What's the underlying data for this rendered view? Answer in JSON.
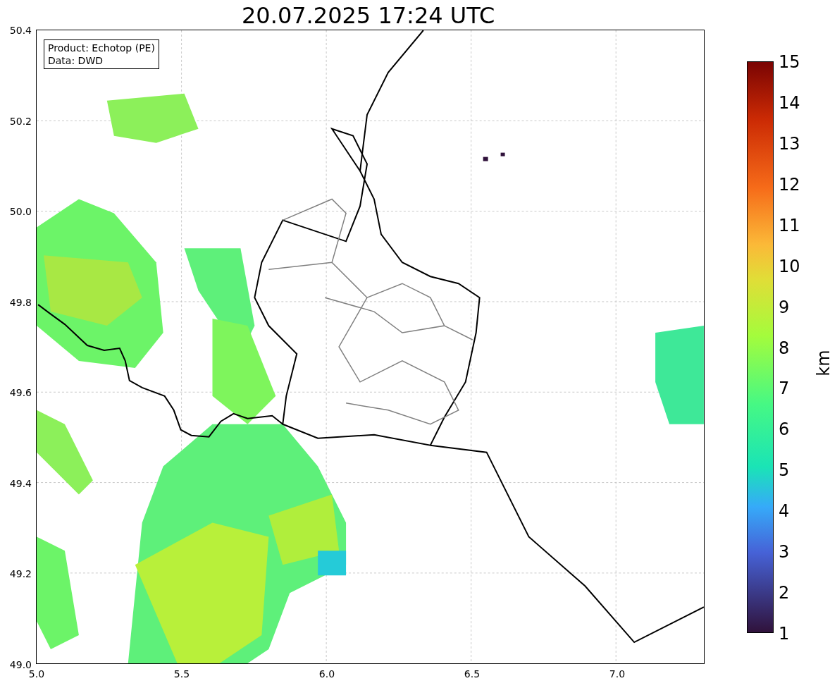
{
  "title": "20.07.2025 17:24 UTC",
  "legend": [
    "Product: Echotop (PE)",
    "Data: DWD"
  ],
  "y_ticks": [
    "50.4",
    "50.2",
    "50.0",
    "49.8",
    "49.6",
    "49.4",
    "49.2",
    "49.0"
  ],
  "x_ticks": [
    "5.0",
    "5.5",
    "6.0",
    "6.5",
    "7.0"
  ],
  "colorbar": {
    "label": "km",
    "ticks": [
      "15",
      "14",
      "13",
      "12",
      "11",
      "10",
      "9",
      "8",
      "7",
      "6",
      "5",
      "4",
      "3",
      "2",
      "1"
    ]
  }
}
